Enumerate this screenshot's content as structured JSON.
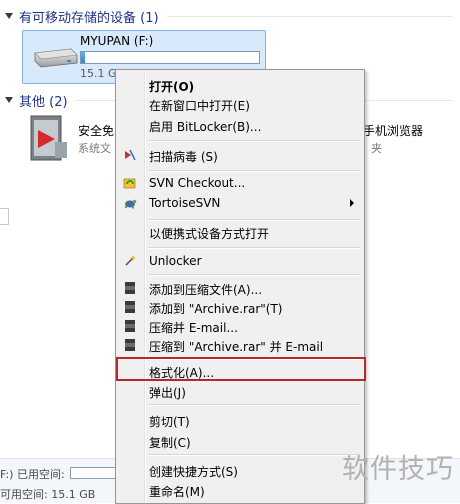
{
  "groups": {
    "removable": "有可移动存储的设备 (1)",
    "other": "其他 (2)"
  },
  "drive": {
    "name": "MYUPAN (F:)",
    "free_text": "15.1 GB",
    "used_fraction": 0.02
  },
  "other_items": {
    "left_name": "安全免",
    "left_sub": "系统文",
    "right_name": "手机浏览器",
    "right_sub": "夹"
  },
  "context_menu": {
    "items": [
      {
        "label": "打开(O)",
        "bold": true,
        "icon": "none"
      },
      {
        "label": "在新窗口中打开(E)",
        "icon": "none"
      },
      {
        "label": "启用 BitLocker(B)...",
        "icon": "none"
      },
      {
        "label": "扫描病毒 (S)",
        "icon": "antivirus-icon"
      },
      {
        "label": "SVN Checkout...",
        "icon": "svn-checkout-icon"
      },
      {
        "label": "TortoiseSVN",
        "icon": "tortoisesvn-icon",
        "submenu": true
      },
      {
        "label": "以便携式设备方式打开",
        "icon": "none"
      },
      {
        "label": "Unlocker",
        "icon": "wand-icon"
      },
      {
        "label": "添加到压缩文件(A)...",
        "icon": "archive-icon"
      },
      {
        "label": "添加到 \"Archive.rar\"(T)",
        "icon": "archive-icon"
      },
      {
        "label": "压缩并 E-mail...",
        "icon": "archive-icon"
      },
      {
        "label": "压缩到 \"Archive.rar\" 并 E-mail",
        "icon": "archive-icon"
      },
      {
        "label": "格式化(A)...",
        "icon": "none"
      },
      {
        "label": "弹出(J)",
        "icon": "none"
      },
      {
        "label": "剪切(T)",
        "icon": "none"
      },
      {
        "label": "复制(C)",
        "icon": "none"
      },
      {
        "label": "创建快捷方式(S)",
        "icon": "none"
      },
      {
        "label": "重命名(M)",
        "icon": "none"
      }
    ]
  },
  "status": {
    "used_label": "F:) 已用空间:",
    "free_label": "可用空间: 15.1 GB"
  },
  "watermark": "软件技巧",
  "colors": {
    "highlight_box": "#b22a2e",
    "selected_tile": "#d8e9fb"
  }
}
